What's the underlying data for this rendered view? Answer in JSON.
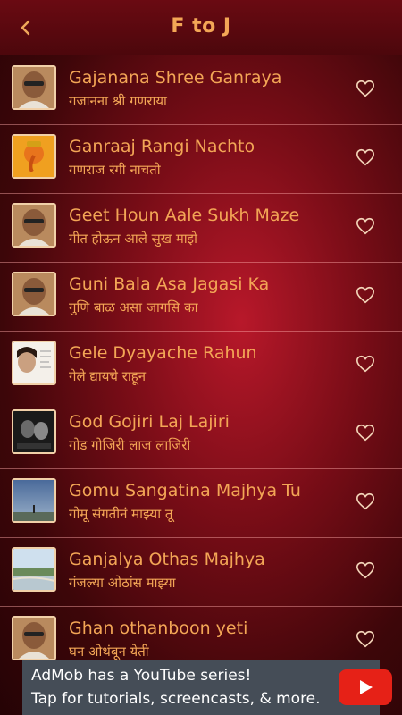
{
  "header": {
    "title": "F to J",
    "back_icon": "back-arrow-icon"
  },
  "colors": {
    "accent": "#f3a656",
    "header_bg": "#5a080e",
    "row_divider": "#ffaaaa"
  },
  "songs": [
    {
      "title": "Gajanana Shree Ganraya",
      "subtitle": "गजानना श्री गणराया",
      "thumb": "singer-portrait"
    },
    {
      "title": "Ganraaj Rangi Nachto",
      "subtitle": "गणराज रंगी नाचतो",
      "thumb": "ganesha"
    },
    {
      "title": "Geet Houn Aale Sukh Maze",
      "subtitle": "गीत होऊन आले सुख माझे",
      "thumb": "singer-portrait"
    },
    {
      "title": "Guni Bala Asa Jagasi Ka",
      "subtitle": "गुणि बाळ असा जागसि का",
      "thumb": "singer-portrait"
    },
    {
      "title": "Gele Dyayache Rahun",
      "subtitle": "गेले द्यायचे राहून",
      "thumb": "singer-female"
    },
    {
      "title": "God Gojiri Laj Lajiri",
      "subtitle": "गोड गोजिरी लाज लाजिरी",
      "thumb": "movie-still"
    },
    {
      "title": "Gomu Sangatina Majhya Tu",
      "subtitle": "गोमू संगतीनं माझ्या तू",
      "thumb": "sky-landscape"
    },
    {
      "title": "Ganjalya Othas Majhya",
      "subtitle": "गंजल्या ओठांस माझ्या",
      "thumb": "river-landscape"
    },
    {
      "title": "Ghan othanboon yeti",
      "subtitle": "घन ओथंबून येती",
      "thumb": "singer-portrait"
    }
  ],
  "ad": {
    "line1": "AdMob has a YouTube series!",
    "line2": "Tap for tutorials, screencasts, & more.",
    "icon": "youtube-play-icon"
  }
}
